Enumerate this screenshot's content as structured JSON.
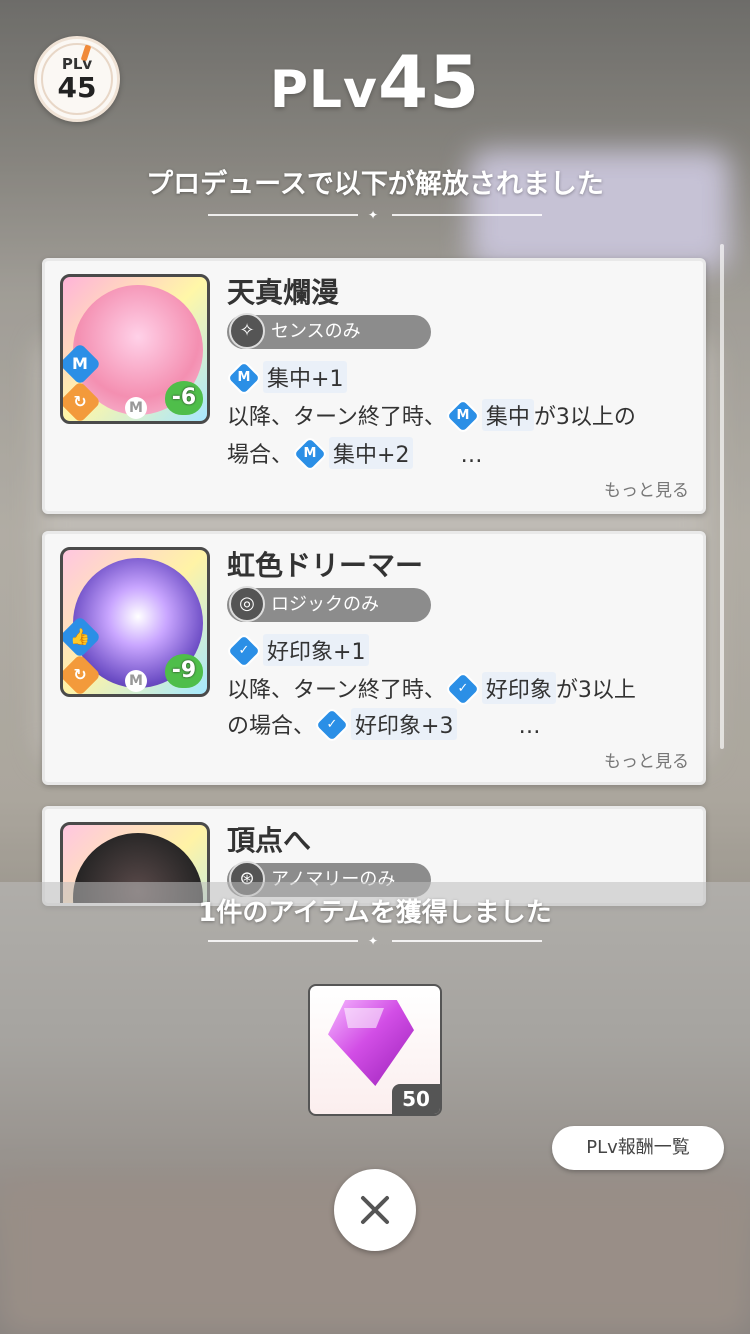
{
  "level_badge": {
    "label": "PLv",
    "value": "45"
  },
  "header": {
    "title_prefix": "PLv",
    "title_number": "45",
    "subtitle": "プロデュースで以下が解放されました"
  },
  "cards": [
    {
      "name": "天真爛漫",
      "tag": "センスのみ",
      "tag_icon": "sense-star-icon",
      "cost": "-6",
      "effect_line1": {
        "icon": "focus-icon",
        "text": "集中",
        "value": "+1"
      },
      "effect_line2_prefix": "以降、ターン終了時、",
      "effect_line2_chip": "集中",
      "effect_line2_suffix": "が3以上の",
      "effect_line3_prefix": "場合、",
      "effect_line3_chip": "集中",
      "effect_line3_value": "+2",
      "ellipsis": "…",
      "more": "もっと見る"
    },
    {
      "name": "虹色ドリーマー",
      "tag": "ロジックのみ",
      "tag_icon": "logic-maze-icon",
      "cost": "-9",
      "effect_line1": {
        "icon": "goodimpression-icon",
        "text": "好印象",
        "value": "+1"
      },
      "effect_line2_prefix": "以降、ターン終了時、",
      "effect_line2_chip": "好印象",
      "effect_line2_suffix": "が3以上",
      "effect_line3_prefix": "の場合、",
      "effect_line3_chip": "好印象",
      "effect_line3_value": "+3",
      "ellipsis": "…",
      "more": "もっと見る"
    },
    {
      "name": "頂点へ",
      "tag": "アノマリーのみ"
    }
  ],
  "reward": {
    "title": "1件のアイテムを獲得しました",
    "item_count": "50",
    "rewards_button": "PLv報酬一覧"
  },
  "colors": {
    "card_bg": "#f7f7f7",
    "chip_blue": "#2b8fe6",
    "tag_gray": "#8c8c8c",
    "cost_green": "#4fbe4a"
  }
}
